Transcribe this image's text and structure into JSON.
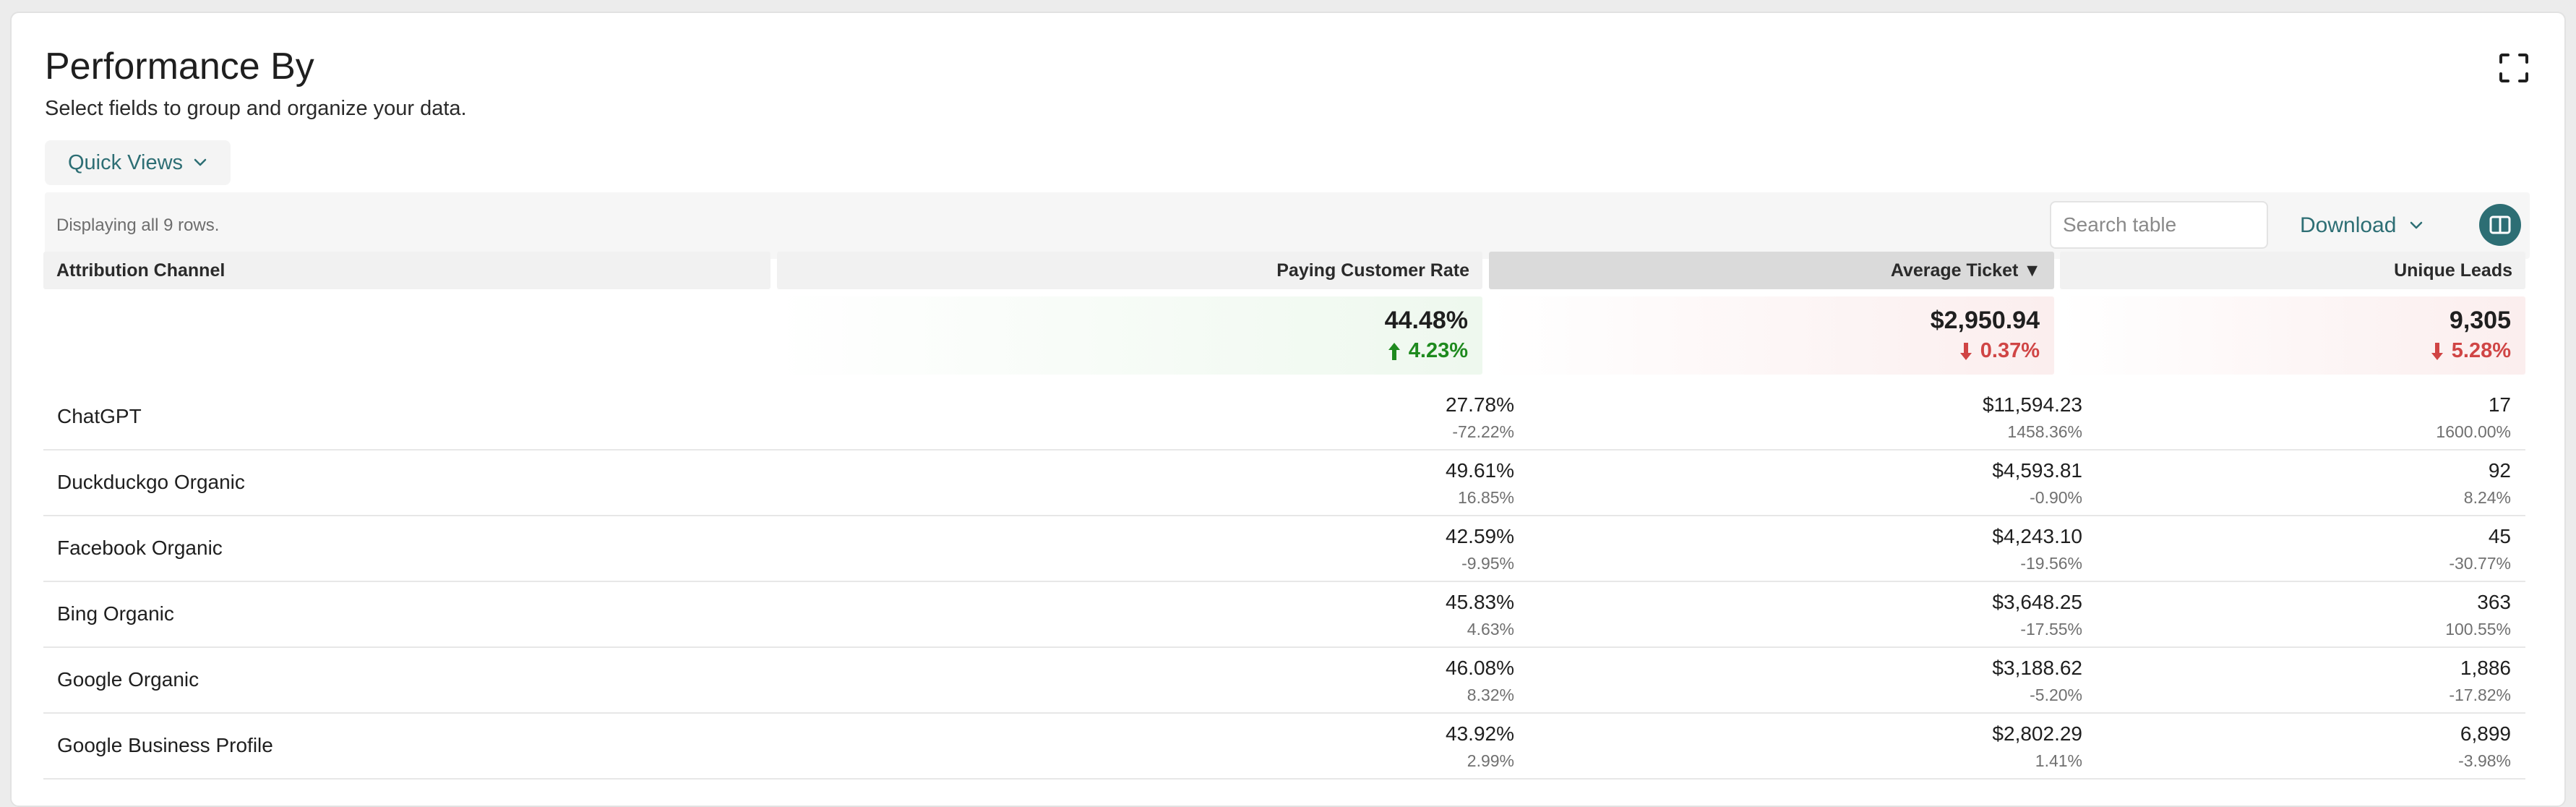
{
  "header": {
    "title": "Performance By",
    "subtitle": "Select fields to group and organize your data."
  },
  "quick_views": {
    "label": "Quick Views"
  },
  "toolbar": {
    "row_count": "Displaying all 9 rows.",
    "search_placeholder": "Search table",
    "download_label": "Download"
  },
  "columns": {
    "channel": "Attribution Channel",
    "paying_rate": "Paying Customer Rate",
    "avg_ticket": "Average Ticket ▼",
    "unique_leads": "Unique Leads"
  },
  "totals": {
    "paying_rate": {
      "value": "44.48%",
      "change": "4.23%",
      "direction": "up"
    },
    "avg_ticket": {
      "value": "$2,950.94",
      "change": "0.37%",
      "direction": "down"
    },
    "unique_leads": {
      "value": "9,305",
      "change": "5.28%",
      "direction": "down"
    }
  },
  "rows": [
    {
      "channel": "ChatGPT",
      "paying_rate": "27.78%",
      "paying_rate_change": "-72.22%",
      "avg_ticket": "$11,594.23",
      "avg_ticket_change": "1458.36%",
      "unique_leads": "17",
      "unique_leads_change": "1600.00%"
    },
    {
      "channel": "Duckduckgo Organic",
      "paying_rate": "49.61%",
      "paying_rate_change": "16.85%",
      "avg_ticket": "$4,593.81",
      "avg_ticket_change": "-0.90%",
      "unique_leads": "92",
      "unique_leads_change": "8.24%"
    },
    {
      "channel": "Facebook Organic",
      "paying_rate": "42.59%",
      "paying_rate_change": "-9.95%",
      "avg_ticket": "$4,243.10",
      "avg_ticket_change": "-19.56%",
      "unique_leads": "45",
      "unique_leads_change": "-30.77%"
    },
    {
      "channel": "Bing Organic",
      "paying_rate": "45.83%",
      "paying_rate_change": "4.63%",
      "avg_ticket": "$3,648.25",
      "avg_ticket_change": "-17.55%",
      "unique_leads": "363",
      "unique_leads_change": "100.55%"
    },
    {
      "channel": "Google Organic",
      "paying_rate": "46.08%",
      "paying_rate_change": "8.32%",
      "avg_ticket": "$3,188.62",
      "avg_ticket_change": "-5.20%",
      "unique_leads": "1,886",
      "unique_leads_change": "-17.82%"
    },
    {
      "channel": "Google Business Profile",
      "paying_rate": "43.92%",
      "paying_rate_change": "2.99%",
      "avg_ticket": "$2,802.29",
      "avg_ticket_change": "1.41%",
      "unique_leads": "6,899",
      "unique_leads_change": "-3.98%"
    }
  ],
  "colors": {
    "accent": "#2d6e74",
    "positive": "#1e8a1e",
    "negative": "#d04545"
  },
  "icons": {
    "expand": "expand-icon",
    "quick_views": "chevron-down-icon",
    "download": "chevron-down-icon",
    "columns": "columns-icon",
    "up": "arrow-up-icon",
    "down": "arrow-down-icon"
  }
}
